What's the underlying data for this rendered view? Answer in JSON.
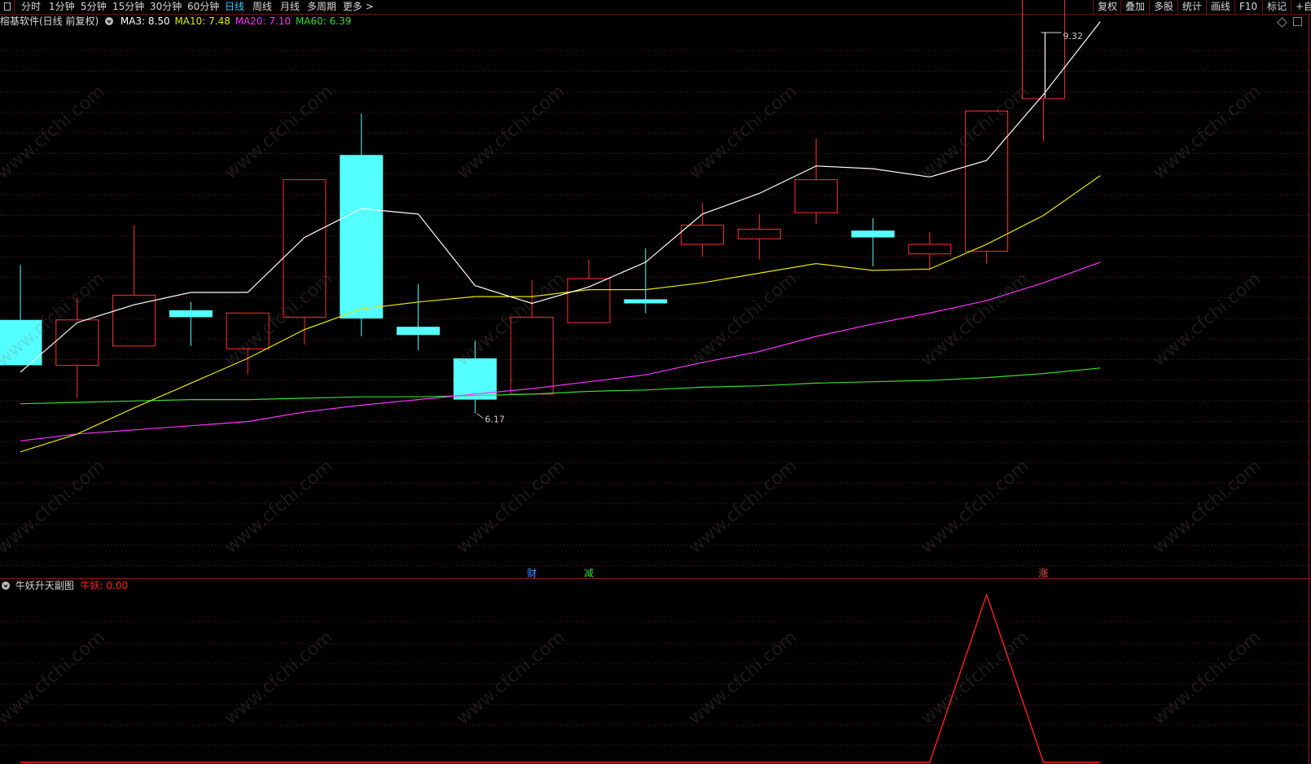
{
  "toolbar": {
    "periods": [
      "分时",
      "1分钟",
      "5分钟",
      "15分钟",
      "30分钟",
      "60分钟",
      "日线",
      "周线",
      "月线",
      "多周期",
      "更多 >"
    ],
    "active_period": "日线",
    "tools": [
      "复权",
      "叠加",
      "多股",
      "统计",
      "画线",
      "F10",
      "标记",
      "+自选"
    ]
  },
  "main_panel": {
    "title": "榕基软件(日线 前复权)",
    "indicators": [
      {
        "label": "MA3: 8.50",
        "color": "#ffffff"
      },
      {
        "label": "MA10: 7.48",
        "color": "#e6e600"
      },
      {
        "label": "MA20: 7.10",
        "color": "#ff33ff"
      },
      {
        "label": "MA60: 6.39",
        "color": "#33dd33"
      }
    ]
  },
  "sub_panel": {
    "title": "牛妖升天副图",
    "indicator": {
      "label": "牛妖: 0.00",
      "color": "#ff2020"
    }
  },
  "watermark": "www.cfchi.com",
  "colors": {
    "up": "#ff3030",
    "down": "#54ffff",
    "grid": "#7a1515",
    "ma3": "#ffffff",
    "ma10": "#e6e600",
    "ma20": "#ff33ff",
    "ma60": "#33dd33",
    "signal": "#ff2020"
  },
  "chart_data": [
    {
      "type": "candlestick",
      "title": "榕基软件(日线 前复权)",
      "y_range": [
        5.5,
        9.5
      ],
      "candles": [
        {
          "open": 7.38,
          "close": 7.05,
          "high": 7.78,
          "low": 7.05
        },
        {
          "open": 7.05,
          "close": 7.38,
          "high": 7.54,
          "low": 6.81
        },
        {
          "open": 7.19,
          "close": 7.56,
          "high": 8.07,
          "low": 7.19
        },
        {
          "open": 7.45,
          "close": 7.4,
          "high": 7.51,
          "low": 7.19
        },
        {
          "open": 7.17,
          "close": 7.43,
          "high": 7.43,
          "low": 6.98
        },
        {
          "open": 7.4,
          "close": 8.4,
          "high": 8.4,
          "low": 7.2
        },
        {
          "open": 8.58,
          "close": 7.39,
          "high": 8.88,
          "low": 7.26
        },
        {
          "open": 7.33,
          "close": 7.27,
          "high": 7.64,
          "low": 7.16
        },
        {
          "open": 7.1,
          "close": 6.8,
          "high": 7.23,
          "low": 6.7
        },
        {
          "open": 6.84,
          "close": 7.4,
          "high": 7.67,
          "low": 6.84
        },
        {
          "open": 7.36,
          "close": 7.68,
          "high": 7.82,
          "low": 7.36
        },
        {
          "open": 7.53,
          "close": 7.5,
          "high": 7.9,
          "low": 7.43
        },
        {
          "open": 7.93,
          "close": 8.07,
          "high": 8.23,
          "low": 7.84
        },
        {
          "open": 7.97,
          "close": 8.04,
          "high": 8.15,
          "low": 7.82
        },
        {
          "open": 8.16,
          "close": 8.4,
          "high": 8.7,
          "low": 8.08
        },
        {
          "open": 8.03,
          "close": 7.98,
          "high": 8.12,
          "low": 7.77
        },
        {
          "open": 7.86,
          "close": 7.93,
          "high": 8.02,
          "low": 7.74
        },
        {
          "open": 7.88,
          "close": 8.9,
          "high": 8.9,
          "low": 7.79
        },
        {
          "open": 8.99,
          "close": 10.15,
          "high": 10.15,
          "low": 8.68
        }
      ],
      "ma3": [
        7.0,
        7.36,
        7.49,
        7.58,
        7.58,
        7.98,
        8.19,
        8.15,
        7.63,
        7.5,
        7.62,
        7.8,
        8.15,
        8.3,
        8.5,
        8.48,
        8.42,
        8.54,
        9.02,
        9.55
      ],
      "ma10": [
        6.42,
        6.55,
        6.74,
        6.92,
        7.1,
        7.31,
        7.46,
        7.51,
        7.55,
        7.55,
        7.6,
        7.6,
        7.65,
        7.72,
        7.79,
        7.74,
        7.75,
        7.93,
        8.14,
        8.43
      ],
      "ma20": [
        6.5,
        6.55,
        6.58,
        6.61,
        6.64,
        6.71,
        6.76,
        6.8,
        6.84,
        6.88,
        6.93,
        6.98,
        7.07,
        7.15,
        7.26,
        7.35,
        7.43,
        7.52,
        7.65,
        7.8
      ],
      "ma60": [
        6.77,
        6.78,
        6.79,
        6.8,
        6.8,
        6.81,
        6.82,
        6.82,
        6.83,
        6.84,
        6.86,
        6.87,
        6.89,
        6.9,
        6.92,
        6.93,
        6.94,
        6.96,
        6.99,
        7.03
      ],
      "annotations": [
        {
          "label": "9.32",
          "kind": "high"
        },
        {
          "label": "6.17",
          "kind": "low"
        }
      ],
      "signals": [
        {
          "label": "财",
          "index": 9,
          "color": "#4499ff"
        },
        {
          "label": "减",
          "index": 10,
          "color": "#33dd33"
        },
        {
          "label": "涨",
          "index": 18,
          "color": "#ff4444"
        }
      ]
    },
    {
      "type": "line",
      "title": "牛妖升天副图",
      "series": [
        {
          "name": "牛妖",
          "values": [
            0,
            0,
            0,
            0,
            0,
            0,
            0,
            0,
            0,
            0,
            0,
            0,
            0,
            0,
            0,
            0,
            0,
            1,
            0,
            0
          ]
        }
      ]
    }
  ]
}
